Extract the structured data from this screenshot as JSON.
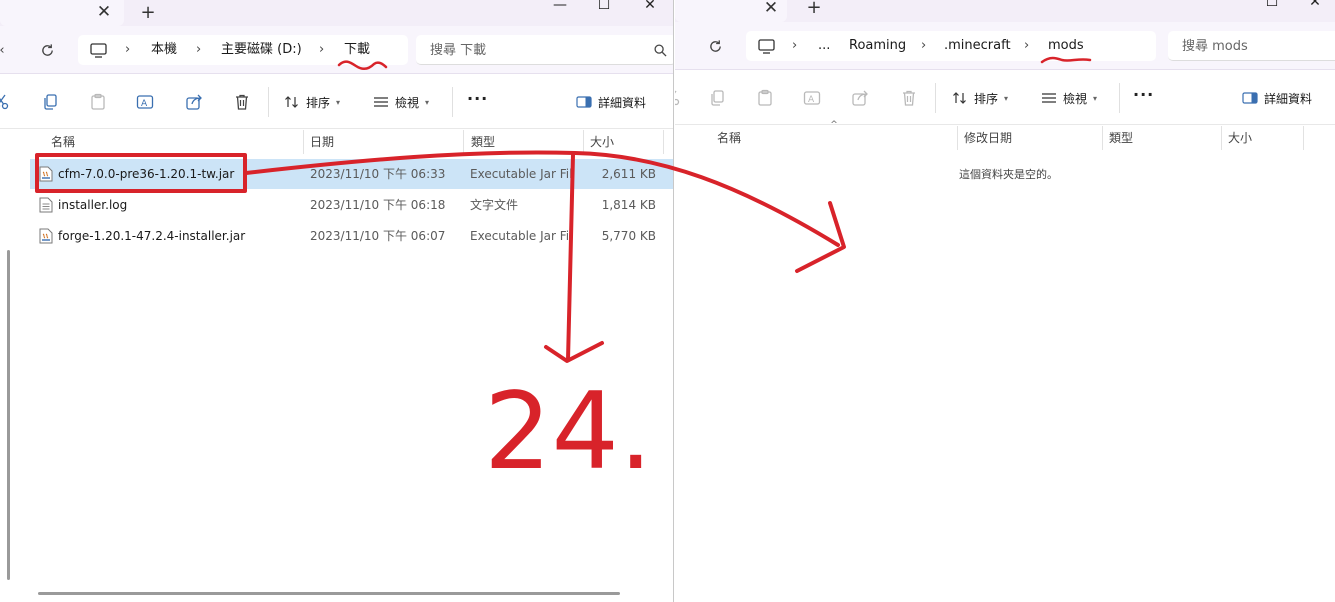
{
  "left_window": {
    "breadcrumb": [
      "本機",
      "主要磁碟 (D:)",
      "下載"
    ],
    "search_placeholder": "搜尋 下載",
    "toolbar": {
      "sort_label": "排序",
      "view_label": "檢視",
      "details_label": "詳細資料"
    },
    "columns": [
      "名稱",
      "日期",
      "類型",
      "大小"
    ],
    "files": [
      {
        "name": "cfm-7.0.0-pre36-1.20.1-tw.jar",
        "date": "2023/11/10 下午 06:33",
        "type": "Executable Jar File",
        "size": "2,611 KB",
        "icon": "jar-file-icon",
        "selected": true
      },
      {
        "name": "installer.log",
        "date": "2023/11/10 下午 06:18",
        "type": "文字文件",
        "size": "1,814 KB",
        "icon": "text-file-icon",
        "selected": false
      },
      {
        "name": "forge-1.20.1-47.2.4-installer.jar",
        "date": "2023/11/10 下午 06:07",
        "type": "Executable Jar File",
        "size": "5,770 KB",
        "icon": "jar-file-icon",
        "selected": false
      }
    ]
  },
  "right_window": {
    "breadcrumb": [
      "...",
      "Roaming",
      ".minecraft",
      "mods"
    ],
    "search_placeholder": "搜尋 mods",
    "toolbar": {
      "sort_label": "排序",
      "view_label": "檢視",
      "details_label": "詳細資料"
    },
    "columns": [
      "名稱",
      "修改日期",
      "類型",
      "大小"
    ],
    "empty_message": "這個資料夾是空的。"
  },
  "annotation": {
    "step_number": "24.",
    "color": "#d8232a"
  },
  "colors": {
    "selection": "#cce4f7",
    "accent": "#3a6fb0",
    "tabbar": "#f3eef8"
  }
}
